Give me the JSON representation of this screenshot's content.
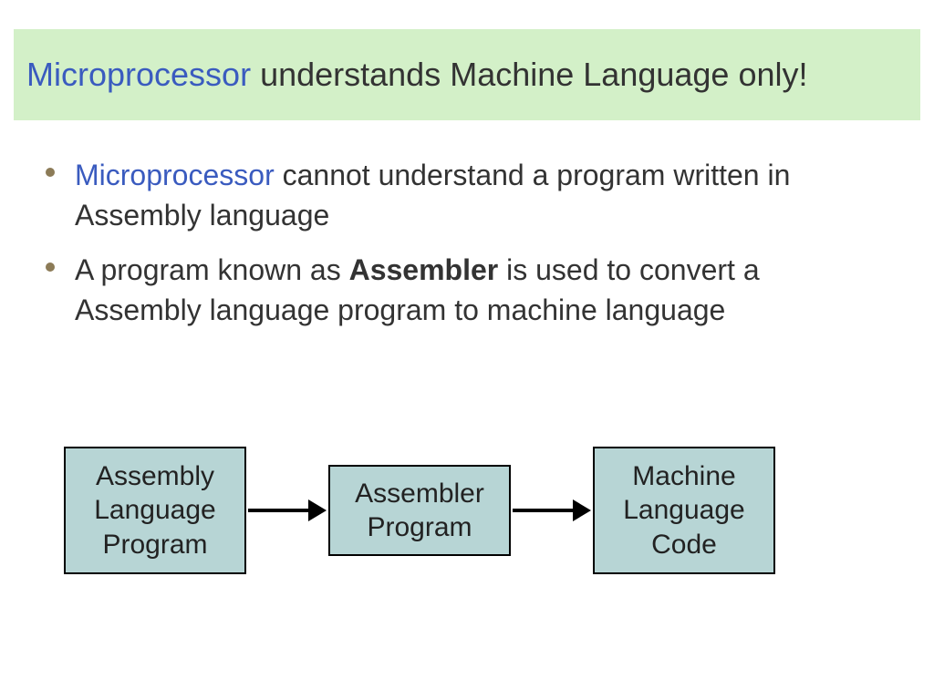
{
  "title": {
    "highlight": "Microprocessor",
    "rest": " understands Machine Language only!"
  },
  "bullets": [
    {
      "highlight": "Microprocessor",
      "rest": " cannot understand a program written in Assembly language"
    },
    {
      "pre": "A program known as ",
      "bold": "Assembler",
      "post": " is used to convert a Assembly language program to machine language"
    }
  ],
  "diagram": {
    "box1": "Assembly Language Program",
    "box2": "Assembler Program",
    "box3": "Machine Language Code"
  }
}
